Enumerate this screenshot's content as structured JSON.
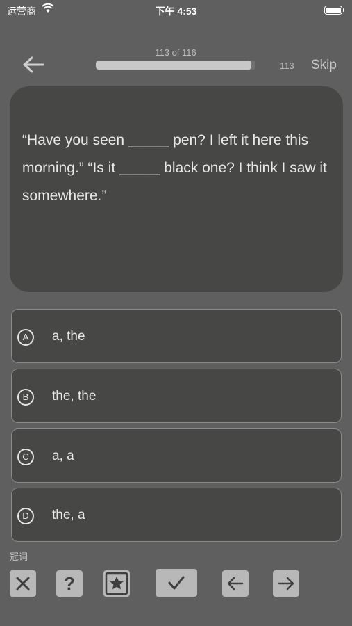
{
  "status_bar": {
    "carrier": "运营商",
    "time": "下午 4:53"
  },
  "header": {
    "progress_label": "113 of 116",
    "progress_fraction": 0.974,
    "progress_count": "113",
    "skip_label": "Skip"
  },
  "question": {
    "text": "“Have you seen _____ pen? I left it here this morning.” “Is it _____ black one? I think I saw it somewhere.”"
  },
  "options": [
    {
      "letter": "A",
      "text": "a, the"
    },
    {
      "letter": "B",
      "text": "the, the"
    },
    {
      "letter": "C",
      "text": "a, a"
    },
    {
      "letter": "D",
      "text": "the, a"
    }
  ],
  "category": "冠词",
  "toolbar": {
    "icons": [
      "close-icon",
      "question-mark-icon",
      "star-icon",
      "checkmark-icon",
      "arrow-left-icon",
      "arrow-right-icon"
    ]
  },
  "colors": {
    "background": "#5f5f5f",
    "card": "#474845",
    "button": "#b8b8b8"
  }
}
